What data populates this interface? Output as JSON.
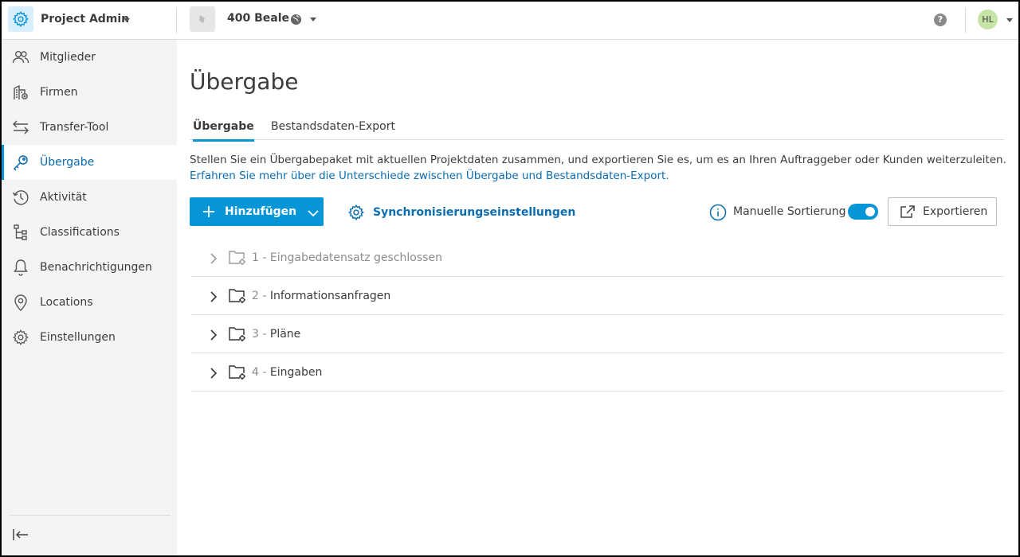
{
  "header": {
    "app_title": "Project Admin",
    "app_icon": "gear-icon",
    "project_name": "400 Beale",
    "project_icon": "globe-icon",
    "help_label": "?",
    "avatar_initials": "HL",
    "accent": "#0696d7"
  },
  "sidebar": {
    "items": [
      {
        "label": "Mitglieder",
        "icon": "members-icon"
      },
      {
        "label": "Firmen",
        "icon": "companies-icon"
      },
      {
        "label": "Transfer-Tool",
        "icon": "transfer-icon"
      },
      {
        "label": "Übergabe",
        "icon": "key-icon",
        "active": true
      },
      {
        "label": "Aktivität",
        "icon": "history-icon"
      },
      {
        "label": "Classifications",
        "icon": "classifications-icon"
      },
      {
        "label": "Benachrichtigungen",
        "icon": "bell-icon"
      },
      {
        "label": "Locations",
        "icon": "location-pin-icon"
      },
      {
        "label": "Einstellungen",
        "icon": "gear-icon"
      }
    ],
    "collapse_icon": "collapse-sidebar-icon"
  },
  "main": {
    "title": "Übergabe",
    "tabs": [
      {
        "label": "Übergabe",
        "active": true
      },
      {
        "label": "Bestandsdaten-Export",
        "active": false
      }
    ],
    "description": "Stellen Sie ein Übergabepaket mit aktuellen Projektdaten zusammen, und exportieren Sie es, um es an Ihren Auftraggeber oder Kunden weiterzuleiten.",
    "learn_more_link": "Erfahren Sie mehr über die Unterschiede zwischen Übergabe und Bestandsdaten-Export.",
    "add_button": "Hinzufügen",
    "sync_settings": "Synchronisierungseinstellungen",
    "manual_sort_label": "Manuelle Sortierung",
    "manual_sort_on": true,
    "export_button": "Exportieren",
    "rows": [
      {
        "num": "1 -",
        "label": "Eingabedatensatz geschlossen",
        "dimmed": true
      },
      {
        "num": "2 -",
        "label": "Informationsanfragen",
        "dimmed": false
      },
      {
        "num": "3 -",
        "label": "Pläne",
        "dimmed": false
      },
      {
        "num": "4 -",
        "label": "Eingaben",
        "dimmed": false
      }
    ]
  }
}
